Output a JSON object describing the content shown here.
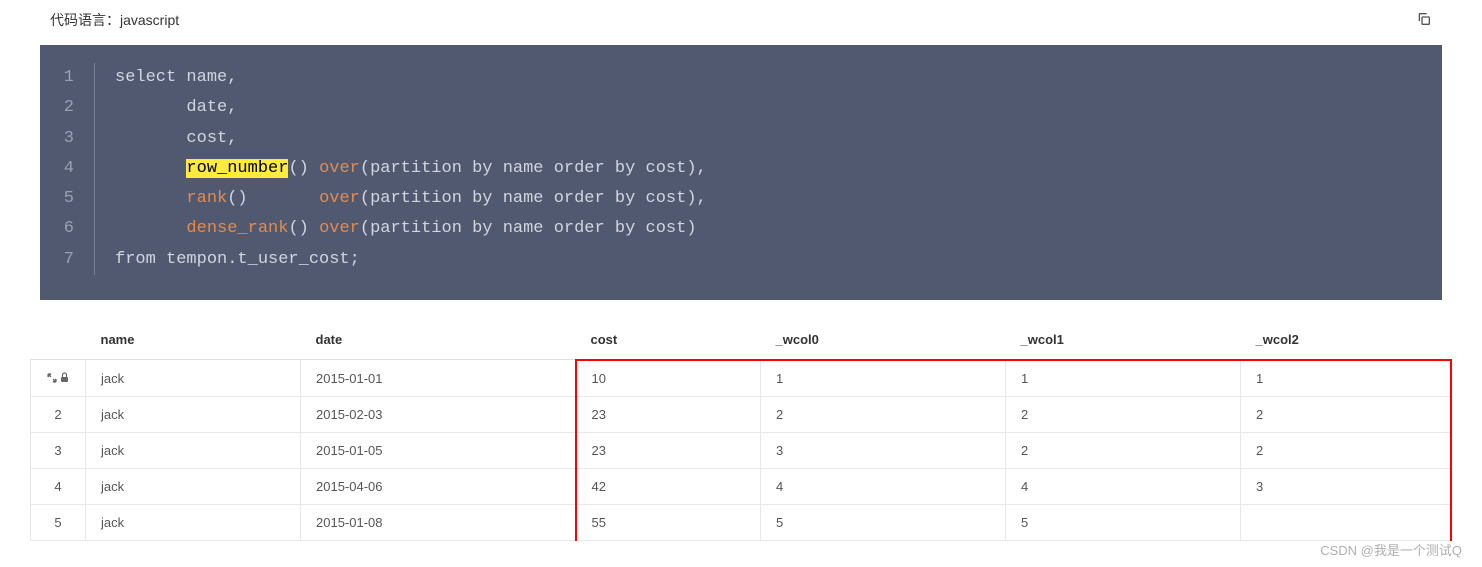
{
  "header": {
    "langLabel": "代码语言：",
    "langValue": "javascript"
  },
  "code": {
    "lines": [
      {
        "n": "1",
        "segments": [
          {
            "t": "select",
            "c": "kw-select"
          },
          {
            "t": " name,"
          }
        ]
      },
      {
        "n": "2",
        "segments": [
          {
            "t": "       date,"
          }
        ]
      },
      {
        "n": "3",
        "segments": [
          {
            "t": "       cost,"
          }
        ]
      },
      {
        "n": "4",
        "segments": [
          {
            "t": "       "
          },
          {
            "t": "row_number",
            "c": "highlight"
          },
          {
            "t": "() "
          },
          {
            "t": "over",
            "c": "kw-over"
          },
          {
            "t": "(partition by name order by cost),"
          }
        ]
      },
      {
        "n": "5",
        "segments": [
          {
            "t": "       "
          },
          {
            "t": "rank",
            "c": "kw-rank"
          },
          {
            "t": "()       "
          },
          {
            "t": "over",
            "c": "kw-over"
          },
          {
            "t": "(partition by name order by cost),"
          }
        ]
      },
      {
        "n": "6",
        "segments": [
          {
            "t": "       "
          },
          {
            "t": "dense_rank",
            "c": "kw-rank"
          },
          {
            "t": "() "
          },
          {
            "t": "over",
            "c": "kw-over"
          },
          {
            "t": "(partition by name order by cost)"
          }
        ]
      },
      {
        "n": "7",
        "segments": [
          {
            "t": "from tempon.t_user_cost;"
          }
        ]
      }
    ]
  },
  "table": {
    "headers": [
      "name",
      "date",
      "cost",
      "_wcol0",
      "_wcol1",
      "_wcol2"
    ],
    "rows": [
      {
        "rownum_icons": true,
        "cells": [
          "jack",
          "2015-01-01",
          "10",
          "1",
          "1",
          "1"
        ]
      },
      {
        "rownum": "2",
        "cells": [
          "jack",
          "2015-02-03",
          "23",
          "2",
          "2",
          "2"
        ]
      },
      {
        "rownum": "3",
        "cells": [
          "jack",
          "2015-01-05",
          "23",
          "3",
          "2",
          "2"
        ]
      },
      {
        "rownum": "4",
        "cells": [
          "jack",
          "2015-04-06",
          "42",
          "4",
          "4",
          "3"
        ]
      },
      {
        "rownum": "5",
        "cells": [
          "jack",
          "2015-01-08",
          "55",
          "5",
          "5",
          ""
        ]
      }
    ]
  },
  "watermark": "CSDN @我是一个测试Q"
}
